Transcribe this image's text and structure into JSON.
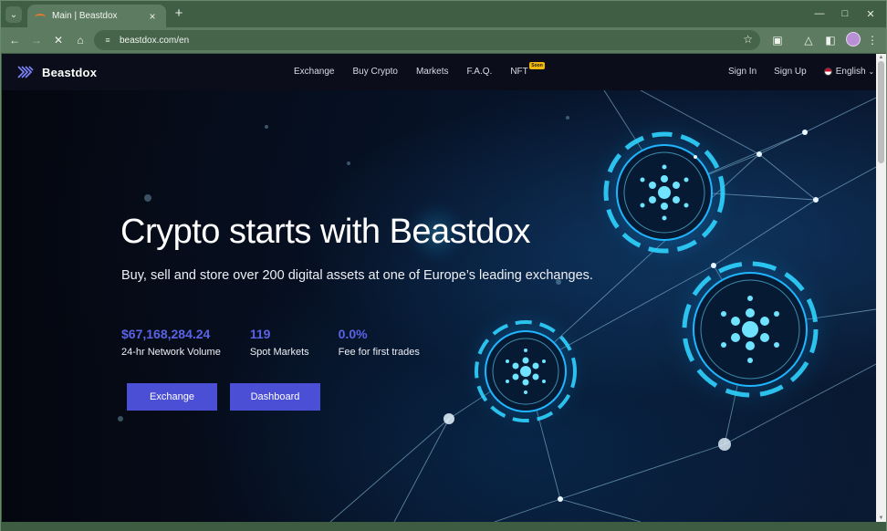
{
  "browser": {
    "tab": {
      "title": "Main | Beastdox"
    },
    "url": "beastdox.com/en"
  },
  "site": {
    "brand": "Beastdox",
    "nav": [
      {
        "label": "Exchange"
      },
      {
        "label": "Buy Crypto"
      },
      {
        "label": "Markets"
      },
      {
        "label": "F.A.Q."
      },
      {
        "label": "NFT",
        "badge": "Soon"
      }
    ],
    "signin": "Sign In",
    "signup": "Sign Up",
    "language": "English"
  },
  "hero": {
    "headline": "Crypto starts with Beastdox",
    "subline": "Buy, sell and store over 200 digital assets at one of Europe’s leading exchanges.",
    "stats": [
      {
        "value": "$67,168,284.24",
        "label": "24-hr Network Volume"
      },
      {
        "value": "119",
        "label": "Spot Markets"
      },
      {
        "value": "0.0%",
        "label": "Fee for first trades"
      }
    ],
    "buttons": {
      "exchange": "Exchange",
      "dashboard": "Dashboard"
    }
  },
  "colors": {
    "accent": "#4b4fd6",
    "stat": "#5a63e6",
    "browser_frame": "#5d7b61"
  }
}
